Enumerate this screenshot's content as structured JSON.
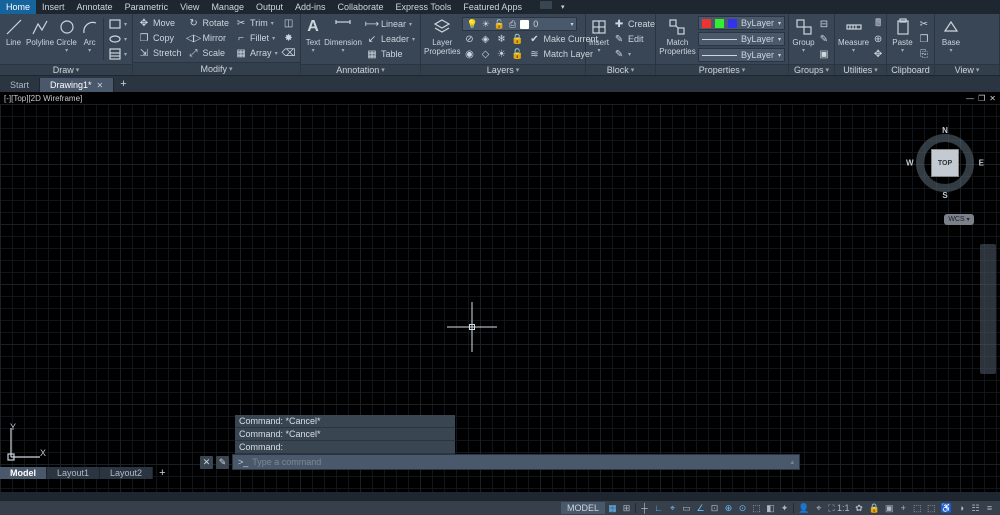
{
  "menu": {
    "items": [
      "Home",
      "Insert",
      "Annotate",
      "Parametric",
      "View",
      "Manage",
      "Output",
      "Add-ins",
      "Collaborate",
      "Express Tools",
      "Featured Apps"
    ],
    "active": 0
  },
  "panels": {
    "draw": {
      "title": "Draw",
      "line": "Line",
      "polyline": "Polyline",
      "circle": "Circle",
      "arc": "Arc"
    },
    "modify": {
      "title": "Modify",
      "move": "Move",
      "rotate": "Rotate",
      "trim": "Trim",
      "copy": "Copy",
      "mirror": "Mirror",
      "fillet": "Fillet",
      "stretch": "Stretch",
      "scale": "Scale",
      "array": "Array"
    },
    "annotation": {
      "title": "Annotation",
      "text": "Text",
      "dimension": "Dimension",
      "linear": "Linear",
      "leader": "Leader",
      "table": "Table"
    },
    "layers": {
      "title": "Layers",
      "props": "Layer\nProperties",
      "make": "Make Current",
      "match": "Match Layer",
      "current": "0"
    },
    "block": {
      "title": "Block",
      "insert": "Insert",
      "create": "Create",
      "edit": "Edit",
      "editattr": "Edit Attributes"
    },
    "properties": {
      "title": "Properties",
      "match": "Match\nProperties",
      "color": "ByLayer",
      "lweight": "ByLayer",
      "ltype": "ByLayer"
    },
    "groups": {
      "title": "Groups",
      "group": "Group"
    },
    "utilities": {
      "title": "Utilities",
      "measure": "Measure"
    },
    "clipboard": {
      "title": "Clipboard",
      "paste": "Paste"
    },
    "view": {
      "title": "View",
      "base": "Base"
    }
  },
  "filetabs": {
    "items": [
      "Start",
      "Drawing1*"
    ],
    "active": 1
  },
  "viewport": {
    "label": "[-][Top][2D Wireframe]",
    "cube_face": "TOP",
    "wcs": "WCS",
    "dirs": {
      "n": "N",
      "s": "S",
      "e": "E",
      "w": "W"
    },
    "ucs": {
      "x": "X",
      "y": "Y"
    }
  },
  "cmd": {
    "hist": [
      "Command: *Cancel*",
      "Command: *Cancel*",
      "Command:"
    ],
    "placeholder": "Type a command"
  },
  "layout_tabs": {
    "items": [
      "Model",
      "Layout1",
      "Layout2"
    ],
    "active": 0
  },
  "status": {
    "model": "MODEL",
    "scale": "1:1",
    "icons": [
      "▦",
      "⊞",
      "┼",
      "∟",
      "⌖",
      "▭",
      "∠",
      "⊡",
      "⊕",
      "⊙",
      "⬚",
      "◧",
      "✦"
    ],
    "icons2": [
      "👤",
      "⌖",
      "⛶ 1:1",
      "✿",
      "🔒",
      "▣",
      "+",
      "⬚",
      "⬚",
      "♿",
      "◑",
      "☷",
      "≡"
    ]
  }
}
